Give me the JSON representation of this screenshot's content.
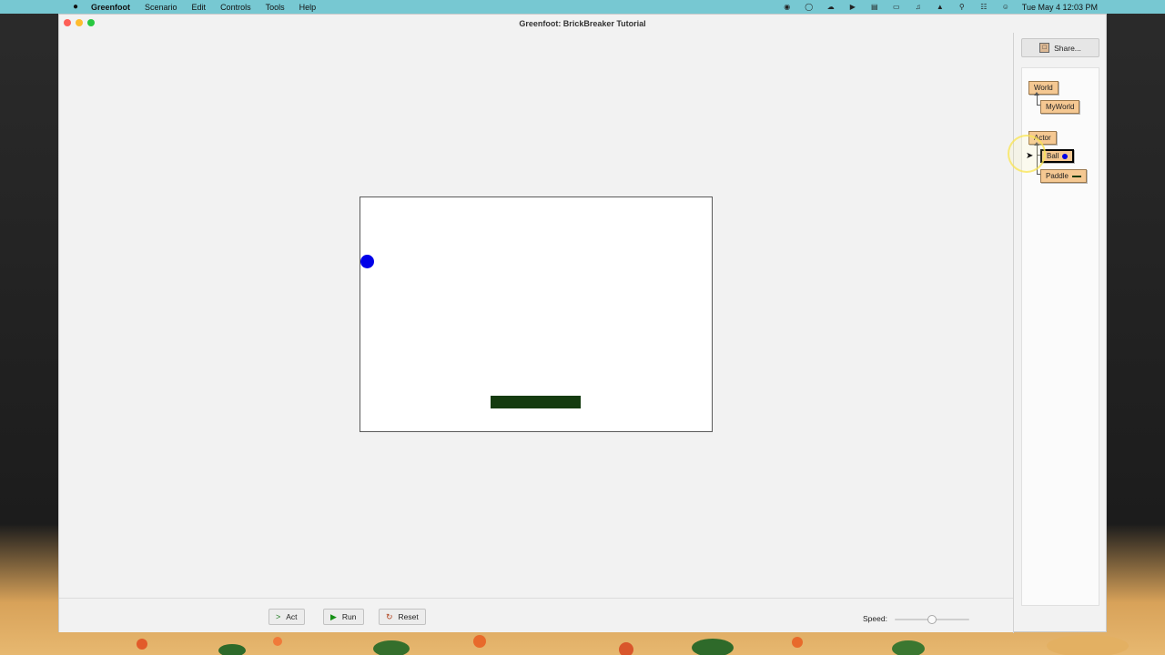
{
  "menubar": {
    "apple_icon": "apple-icon",
    "items": [
      "Greenfoot",
      "Scenario",
      "Edit",
      "Controls",
      "Tools",
      "Help"
    ],
    "tray_icons": [
      "screen-record-icon",
      "siri-icon",
      "cloud-icon",
      "play-icon",
      "calendar-icon",
      "battery-icon",
      "volume-icon",
      "wifi-icon",
      "search-icon",
      "control-center-icon",
      "user-icon"
    ],
    "clock": "Tue May 4  12:03 PM"
  },
  "window": {
    "title": "Greenfoot: BrickBreaker Tutorial"
  },
  "controls": {
    "act_label": "Act",
    "run_label": "Run",
    "reset_label": "Reset",
    "speed_label": "Speed:",
    "speed_value": 0.5
  },
  "side_panel": {
    "share_label": "Share...",
    "classes": {
      "world": "World",
      "myworld": "MyWorld",
      "actor": "Actor",
      "ball": "Ball",
      "paddle": "Paddle"
    }
  },
  "colors": {
    "menubar": "#77c8d2",
    "ball": "#0000e8",
    "paddle": "#143b0f",
    "class_box": "#f5c892"
  }
}
